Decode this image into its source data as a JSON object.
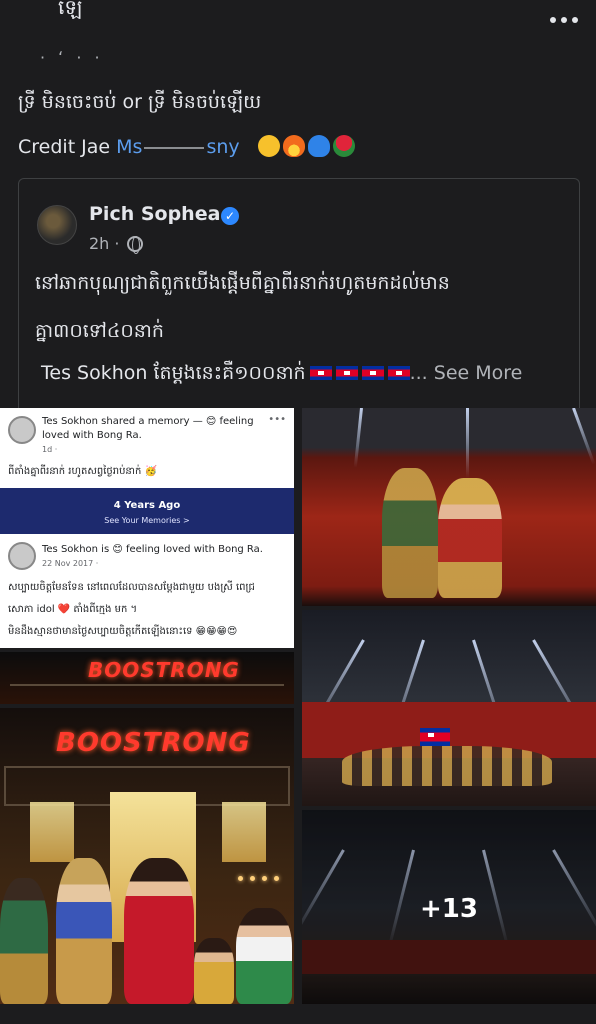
{
  "post": {
    "line1_kh": "ទ្រី មិនចេះចប់ or ទ្រី មិនចប់ឡើយ",
    "credit_prefix": "Credit Jae ",
    "credit_name_start": "Ms",
    "credit_name_end": "sny"
  },
  "shared": {
    "author": "Pich Sophea",
    "time": "2h ·",
    "text_line1": "នៅឆាកបុណ្យជាតិពួកយើងផ្តើមពីគ្នាពីរនាក់រហូតមកដល់មាន",
    "text_line2": "គ្នា៣០ទៅ៤០នាក់",
    "sokhon_line": "Tes Sokhon តែម្តងនេះគឺ១០០នាក់",
    "see_more": "... See More"
  },
  "memory": {
    "shared_line": "Tes Sokhon shared a memory — 😊 feeling",
    "shared_line2": "loved with Bong Ra.",
    "shared_time": "1d · ",
    "shared_text": "ពីតាំងគ្នាពីរនាក់ រហូតសព្វថ្ងៃរាប់នាក់ 🥳",
    "banner_title": "4 Years Ago",
    "banner_sub": "See Your Memories >",
    "orig_line": "Tes Sokhon is 😊 feeling loved with Bong Ra.",
    "orig_time": "22 Nov 2017 · ",
    "orig_text1": "សប្បាយចិត្តមែនទែន នៅពេលដែលបានសម្តែងជាមួយ បងស្រី ពេជ្រ",
    "orig_text2": "សោភា idol ❤️ តាំងពីក្មេង មក ។",
    "orig_text3": "មិនដឹងស្មានថាមានថ្ងៃសប្បាយចិត្តកើតឡើងនោះទេ 😁😁😁😍"
  },
  "gallery": {
    "brand": "BOOSTRONG",
    "more_count": "+13"
  },
  "icons": {
    "verified": "verified-badge-icon",
    "globe": "globe-icon",
    "more": "more-options-icon"
  },
  "colors": {
    "background": "#1c1c1e",
    "link": "#5c9ded",
    "verified": "#2d88ff",
    "brand": "#ff3a2d"
  }
}
